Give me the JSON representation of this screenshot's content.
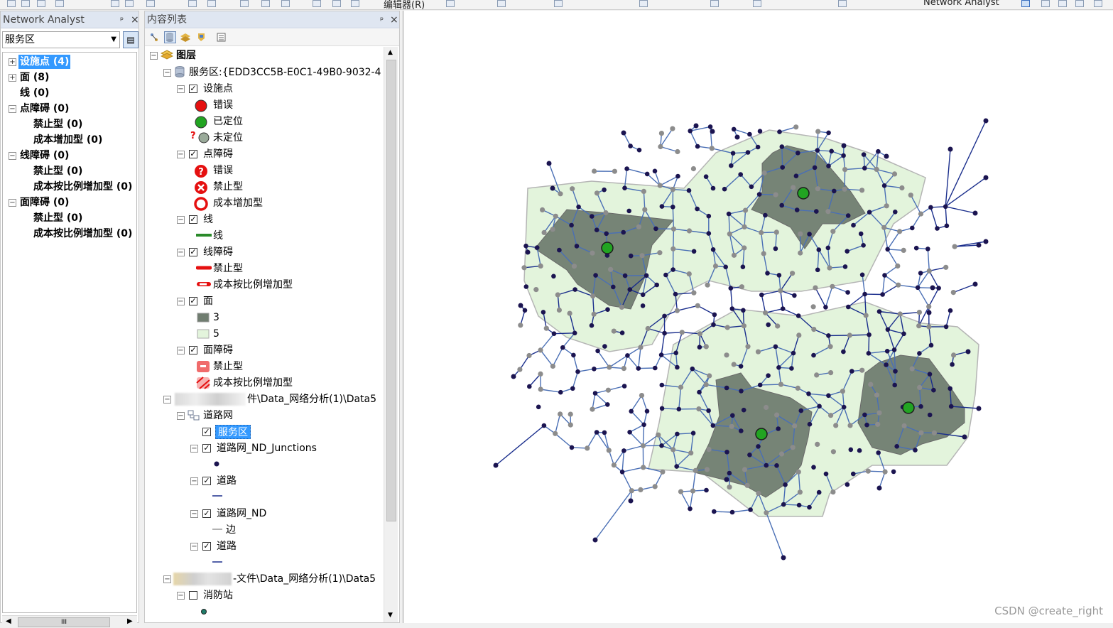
{
  "toolbar": {
    "editor_label": "编辑器(R)",
    "na_label": "Network Analyst"
  },
  "na_panel": {
    "title": "Network Analyst",
    "pin": "ᵖ",
    "close": "×",
    "dropdown_value": "服务区",
    "tree": [
      {
        "label": "设施点 (4)",
        "selected": true,
        "expander": "+"
      },
      {
        "label": "面 (8)",
        "selected": false,
        "expander": "+"
      },
      {
        "label": "线 (0)",
        "selected": false,
        "expander": ""
      },
      {
        "label": "点障碍 (0)",
        "selected": false,
        "expander": "−"
      },
      {
        "label": "禁止型 (0)",
        "selected": false,
        "expander": ""
      },
      {
        "label": "成本增加型 (0)",
        "selected": false,
        "expander": ""
      },
      {
        "label": "线障碍 (0)",
        "selected": false,
        "expander": "−"
      },
      {
        "label": "禁止型 (0)",
        "selected": false,
        "expander": ""
      },
      {
        "label": "成本按比例增加型 (0)",
        "selected": false,
        "expander": ""
      },
      {
        "label": "面障碍 (0)",
        "selected": false,
        "expander": "−"
      },
      {
        "label": "禁止型 (0)",
        "selected": false,
        "expander": ""
      },
      {
        "label": "成本按比例增加型 (0)",
        "selected": false,
        "expander": ""
      }
    ],
    "scroll_thumb": "III"
  },
  "toc_panel": {
    "title": "内容列表",
    "pin": "ᵖ",
    "close": "×",
    "items": [
      {
        "label": "图层",
        "bold": true
      },
      {
        "label": "服务区:{EDD3CC5B-E0C1-49B0-9032-4"
      },
      {
        "label": "设施点"
      },
      {
        "label": "错误"
      },
      {
        "label": "已定位"
      },
      {
        "label": "未定位"
      },
      {
        "label": "点障碍"
      },
      {
        "label": "错误"
      },
      {
        "label": "禁止型"
      },
      {
        "label": "成本增加型"
      },
      {
        "label": "线"
      },
      {
        "label": "线"
      },
      {
        "label": "线障碍"
      },
      {
        "label": "禁止型"
      },
      {
        "label": "成本按比例增加型"
      },
      {
        "label": "面"
      },
      {
        "label": "3"
      },
      {
        "label": "5"
      },
      {
        "label": "面障碍"
      },
      {
        "label": "禁止型"
      },
      {
        "label": "成本按比例增加型"
      },
      {
        "label": "件\\Data_网络分析(1)\\Data5"
      },
      {
        "label": "道路网"
      },
      {
        "label": "服务区",
        "selected": true
      },
      {
        "label": "道路网_ND_Junctions"
      },
      {
        "label": "道路"
      },
      {
        "label": "道路网_ND"
      },
      {
        "label": "边"
      },
      {
        "label": "道路"
      },
      {
        "label": "-文件\\Data_网络分析(1)\\Data5"
      },
      {
        "label": "消防站"
      }
    ],
    "question_mark": "?"
  },
  "map": {
    "watermark": "CSDN @create_right"
  },
  "colors": {
    "road": "#1a2e8c",
    "polygon_outer": "#e3f4dc",
    "polygon_inner": "#707d70",
    "facility": "#22a422",
    "junction": "#1b1450",
    "edge_node": "#8c8c8c",
    "selection": "#3399ff"
  }
}
